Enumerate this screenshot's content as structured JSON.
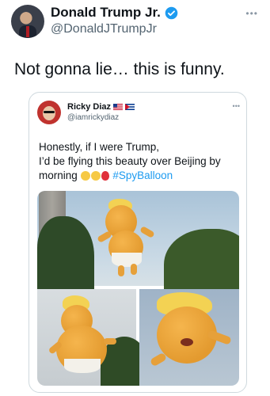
{
  "tweet": {
    "display_name": "Donald Trump Jr.",
    "handle": "@DonaldJTrumpJr",
    "text": "Not gonna lie… this is funny.",
    "more_icon": "more-dots-icon",
    "verified_color": "#1d9bf0"
  },
  "quoted": {
    "display_name": "Ricky Diaz",
    "handle": "@iamrickydiaz",
    "text_line1": "Honestly, if I were Trump,",
    "text_line2": "I’d be flying this beauty over Beijing by",
    "text_line3": "morning",
    "hashtag": "#SpyBalloon",
    "flags": [
      "us-flag-icon",
      "cuba-flag-icon"
    ],
    "emojis": [
      "grinning-sweat-emoji",
      "laughing-emoji",
      "balloon-emoji"
    ]
  },
  "media": {
    "images": [
      "trump-baby-balloon-photo-1",
      "trump-baby-balloon-photo-2",
      "trump-baby-balloon-photo-3"
    ]
  }
}
